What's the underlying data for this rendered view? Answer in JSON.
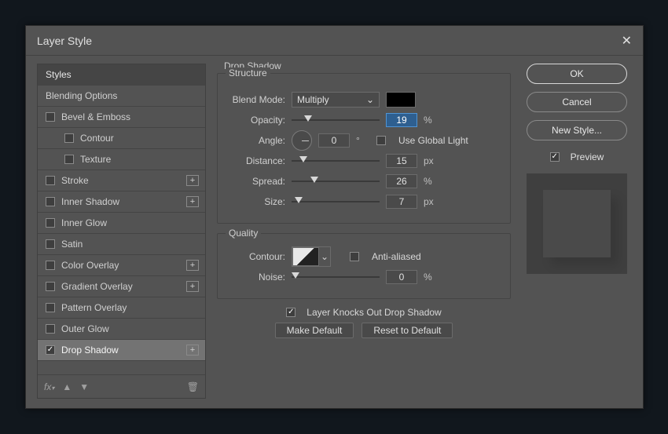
{
  "dialog": {
    "title": "Layer Style"
  },
  "styles": {
    "header": "Styles",
    "blending": "Blending Options",
    "items": [
      {
        "label": "Bevel & Emboss",
        "checked": false,
        "plus": false
      },
      {
        "label": "Contour",
        "checked": false,
        "plus": false,
        "sub": true
      },
      {
        "label": "Texture",
        "checked": false,
        "plus": false,
        "sub": true
      },
      {
        "label": "Stroke",
        "checked": false,
        "plus": true
      },
      {
        "label": "Inner Shadow",
        "checked": false,
        "plus": true
      },
      {
        "label": "Inner Glow",
        "checked": false,
        "plus": false
      },
      {
        "label": "Satin",
        "checked": false,
        "plus": false
      },
      {
        "label": "Color Overlay",
        "checked": false,
        "plus": true
      },
      {
        "label": "Gradient Overlay",
        "checked": false,
        "plus": true
      },
      {
        "label": "Pattern Overlay",
        "checked": false,
        "plus": false
      },
      {
        "label": "Outer Glow",
        "checked": false,
        "plus": false
      },
      {
        "label": "Drop Shadow",
        "checked": true,
        "plus": true,
        "selected": true
      }
    ]
  },
  "panel": {
    "title": "Drop Shadow",
    "structure_label": "Structure",
    "blend_mode_label": "Blend Mode:",
    "blend_mode_value": "Multiply",
    "opacity_label": "Opacity:",
    "opacity_value": "19",
    "opacity_unit": "%",
    "angle_label": "Angle:",
    "angle_value": "0",
    "angle_unit": "°",
    "use_global_label": "Use Global Light",
    "distance_label": "Distance:",
    "distance_value": "15",
    "distance_unit": "px",
    "spread_label": "Spread:",
    "spread_value": "26",
    "spread_unit": "%",
    "size_label": "Size:",
    "size_value": "7",
    "size_unit": "px",
    "quality_label": "Quality",
    "contour_label": "Contour:",
    "antialiased_label": "Anti-aliased",
    "noise_label": "Noise:",
    "noise_value": "0",
    "noise_unit": "%",
    "knockout_label": "Layer Knocks Out Drop Shadow",
    "make_default": "Make Default",
    "reset_default": "Reset to Default"
  },
  "right": {
    "ok": "OK",
    "cancel": "Cancel",
    "new_style": "New Style...",
    "preview": "Preview"
  }
}
